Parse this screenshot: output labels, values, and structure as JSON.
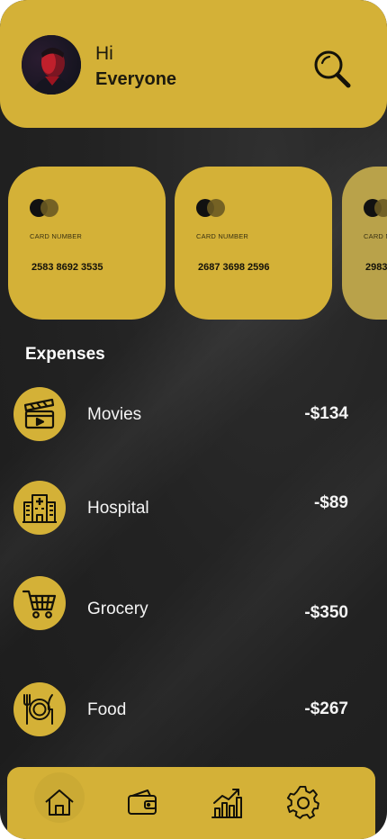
{
  "header": {
    "greeting": "Hi",
    "name": "Everyone"
  },
  "cards": [
    {
      "label": "CARD NUMBER",
      "number": "2583 8692 3535"
    },
    {
      "label": "CARD NUMBER",
      "number": "2687 3698 2596"
    },
    {
      "label": "CARD NUMBER",
      "number": "2983"
    }
  ],
  "expenses": {
    "title": "Expenses",
    "items": [
      {
        "name": "Movies",
        "amount": "-$134",
        "icon": "clapperboard-icon"
      },
      {
        "name": "Hospital",
        "amount": "-$89",
        "icon": "hospital-icon"
      },
      {
        "name": "Grocery",
        "amount": "-$350",
        "icon": "cart-icon"
      },
      {
        "name": "Food",
        "amount": "-$267",
        "icon": "fork-knife-icon"
      }
    ]
  },
  "nav": [
    "home-icon",
    "wallet-icon",
    "chart-icon",
    "settings-icon"
  ],
  "colors": {
    "accent": "#d4b137",
    "background": "#232323",
    "text": "#f4f4f4"
  }
}
